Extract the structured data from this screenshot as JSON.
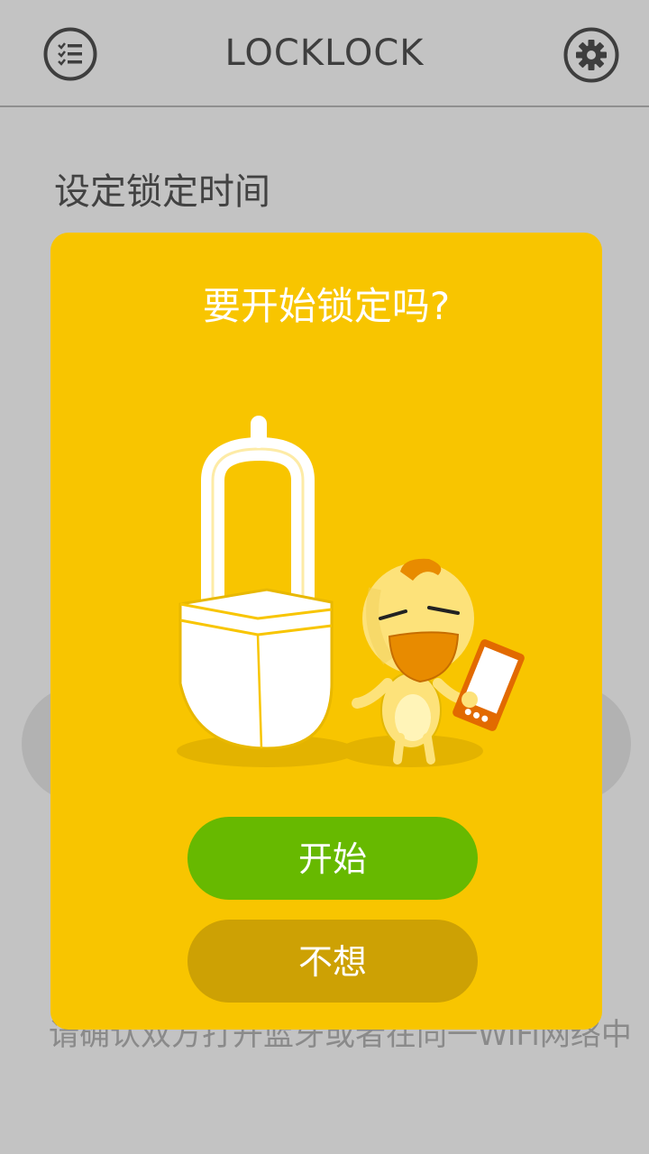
{
  "header": {
    "title": "LOCKLOCK",
    "left_icon": "checklist-icon",
    "right_icon": "gear-icon"
  },
  "main": {
    "section_title": "设定锁定时间",
    "hint": "请确认双方打开蓝牙或者在同一WiFi网络中"
  },
  "dialog": {
    "title": "要开始锁定吗?",
    "illustration": "padlock-and-chick-with-phone",
    "start_label": "开始",
    "cancel_label": "不想"
  },
  "colors": {
    "dialog_bg": "#f8c500",
    "start_button": "#67b900",
    "cancel_button": "#cda104",
    "overlay": "#c3c3c3"
  }
}
